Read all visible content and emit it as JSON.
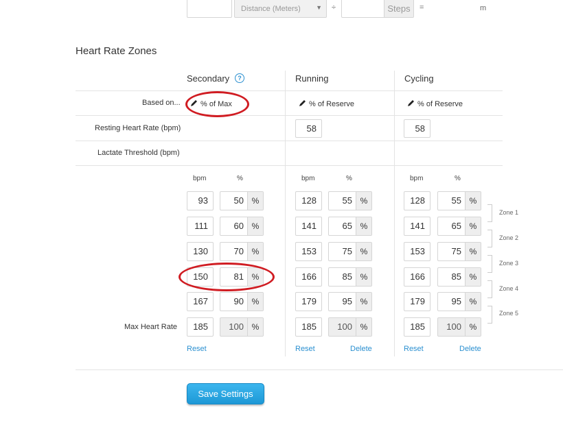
{
  "top_row": {
    "distance_placeholder": "Distance (Meters)",
    "divide_symbol": "÷",
    "steps_label": "Steps",
    "equals_symbol": "=",
    "unit": "m"
  },
  "section_title": "Heart Rate Zones",
  "columns": {
    "secondary": "Secondary",
    "running": "Running",
    "cycling": "Cycling"
  },
  "row_labels": {
    "based_on": "Based on...",
    "resting": "Resting Heart Rate (bpm)",
    "lactate": "Lactate Threshold (bpm)",
    "max_hr": "Max Heart Rate"
  },
  "based_on": {
    "secondary": "% of Max",
    "running": "% of Reserve",
    "cycling": "% of Reserve"
  },
  "resting": {
    "running": "58",
    "cycling": "58"
  },
  "col_headers": {
    "bpm": "bpm",
    "pct": "%"
  },
  "pct_unit": "%",
  "zones": {
    "secondary": {
      "bpm": [
        "93",
        "111",
        "130",
        "150",
        "167",
        "185"
      ],
      "pct": [
        "50",
        "60",
        "70",
        "81",
        "90",
        "100"
      ]
    },
    "running": {
      "bpm": [
        "128",
        "141",
        "153",
        "166",
        "179",
        "185"
      ],
      "pct": [
        "55",
        "65",
        "75",
        "85",
        "95",
        "100"
      ]
    },
    "cycling": {
      "bpm": [
        "128",
        "141",
        "153",
        "166",
        "179",
        "185"
      ],
      "pct": [
        "55",
        "65",
        "75",
        "85",
        "95",
        "100"
      ]
    }
  },
  "zone_labels": [
    "Zone 1",
    "Zone 2",
    "Zone 3",
    "Zone 4",
    "Zone 5"
  ],
  "links": {
    "reset": "Reset",
    "delete": "Delete"
  },
  "save_button": "Save Settings",
  "colors": {
    "accent": "#2a8fd0",
    "annotation": "#d01c22",
    "button": "#1d98d6"
  }
}
